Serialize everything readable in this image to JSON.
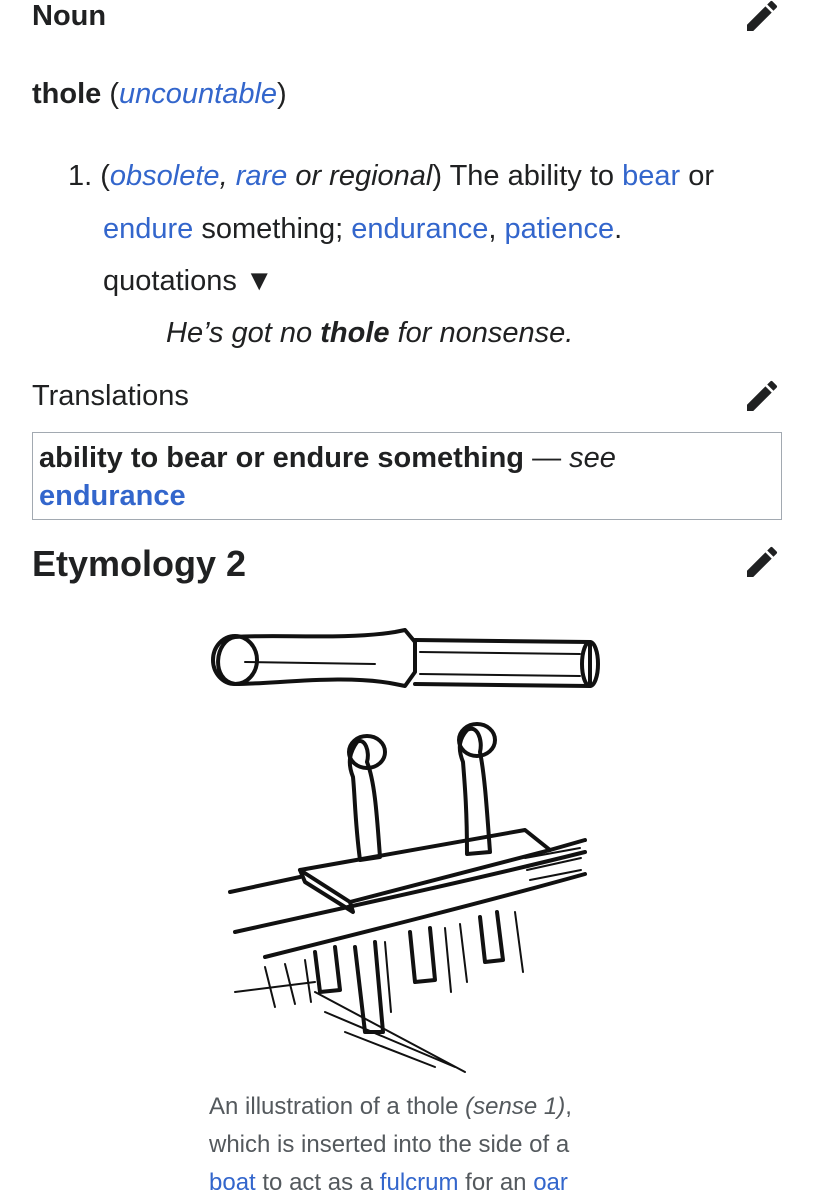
{
  "noun_section": {
    "heading": "Noun"
  },
  "headword": {
    "word": "thole",
    "open_paren": "(",
    "label": "uncountable",
    "close_paren": ")"
  },
  "sense": {
    "number": "1.",
    "open_paren": "(",
    "labels": [
      "obsolete",
      ",",
      "rare",
      "or regional"
    ],
    "close_paren": ")",
    "def_prefix": "The ability to",
    "link_bear": "bear",
    "word_or": "or",
    "link_endure": "endure",
    "word_something": "something;",
    "link_endurance": "endurance",
    "comma": ",",
    "link_patience": "patience",
    "period": "."
  },
  "quotations": {
    "label": "quotations",
    "toggle": "▼"
  },
  "usage_example": {
    "before": "He’s got no",
    "bold": "thole",
    "after": "for nonsense."
  },
  "translations": {
    "heading": "Translations",
    "gloss": "ability to bear or endure something",
    "dash": "—",
    "see": "see",
    "link": "endurance"
  },
  "etymology": {
    "heading": "Etymology 2"
  },
  "figure": {
    "caption_lines": [
      {
        "text": "An illustration of a thole",
        "italic": "(sense 1)",
        "tail": ","
      },
      {
        "text": "which is inserted into the side of a"
      },
      {
        "link1": "boat",
        "mid": "to act as a",
        "link2": "fulcrum",
        "mid2": "for an",
        "link3": "oar"
      }
    ]
  },
  "colors": {
    "link": "#3366cc",
    "text": "#202122",
    "caption": "#54595d",
    "border": "#a2a9b1"
  }
}
